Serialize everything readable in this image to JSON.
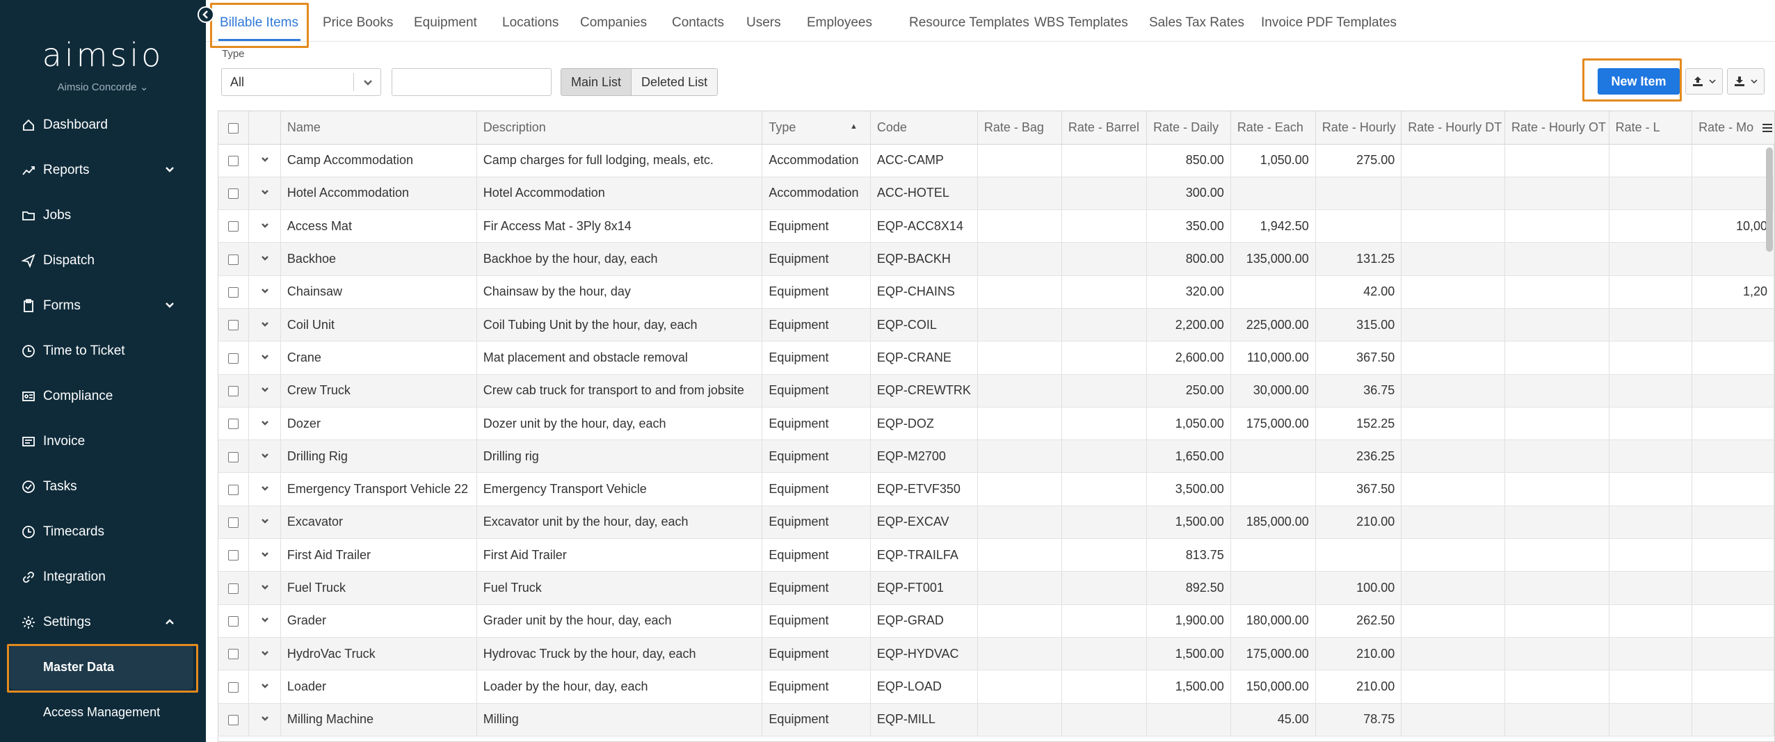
{
  "sidebar": {
    "logo": "aimsio",
    "company": "Aimsio Concorde ⌄",
    "items": [
      {
        "label": "Dashboard",
        "icon": "home-icon"
      },
      {
        "label": "Reports",
        "icon": "chart-icon",
        "expandable": true
      },
      {
        "label": "Jobs",
        "icon": "folder-icon"
      },
      {
        "label": "Dispatch",
        "icon": "send-icon"
      },
      {
        "label": "Forms",
        "icon": "clipboard-icon",
        "expandable": true
      },
      {
        "label": "Time to Ticket",
        "icon": "clock-icon"
      },
      {
        "label": "Compliance",
        "icon": "id-card-icon"
      },
      {
        "label": "Invoice",
        "icon": "invoice-icon"
      },
      {
        "label": "Tasks",
        "icon": "check-circle-icon"
      },
      {
        "label": "Timecards",
        "icon": "clock-icon"
      },
      {
        "label": "Integration",
        "icon": "link-icon"
      },
      {
        "label": "Settings",
        "icon": "gear-icon",
        "expanded": true
      }
    ],
    "sub_items": [
      "Master Data",
      "Access Management"
    ]
  },
  "tabs": [
    "Billable Items",
    "Price Books",
    "Equipment",
    "Locations",
    "Companies",
    "Contacts",
    "Users",
    "Employees",
    "Resource Templates",
    "WBS Templates",
    "Sales Tax Rates",
    "Invoice PDF Templates"
  ],
  "active_tab": "Billable Items",
  "filters": {
    "type_label": "Type",
    "type_value": "All",
    "search_value": "",
    "list_toggle": [
      "Main List",
      "Deleted List"
    ],
    "active_list": "Main List"
  },
  "toolbar": {
    "new_item_label": "New Item"
  },
  "colors": {
    "accent": "#1f77e0",
    "sidebar_bg": "#0f2b3a",
    "highlight": "#e48a1e"
  },
  "table": {
    "columns": [
      "Name",
      "Description",
      "Type",
      "Code",
      "Rate - Bag",
      "Rate - Barrel",
      "Rate - Daily",
      "Rate - Each",
      "Rate - Hourly",
      "Rate - Hourly DT",
      "Rate - Hourly OT",
      "Rate - L",
      "Rate - Mo"
    ],
    "sorted_column": "Type",
    "rows": [
      [
        "Camp Accommodation",
        "Camp charges for full lodging, meals, etc.",
        "Accommodation",
        "ACC-CAMP",
        "",
        "",
        "850.00",
        "1,050.00",
        "275.00",
        "",
        "",
        "",
        ""
      ],
      [
        "Hotel Accommodation",
        "Hotel Accommodation",
        "Accommodation",
        "ACC-HOTEL",
        "",
        "",
        "300.00",
        "",
        "",
        "",
        "",
        "",
        ""
      ],
      [
        "Access Mat",
        "Fir Access Mat - 3Ply 8x14",
        "Equipment",
        "EQP-ACC8X14",
        "",
        "",
        "350.00",
        "1,942.50",
        "",
        "",
        "",
        "",
        "10,00"
      ],
      [
        "Backhoe",
        "Backhoe by the hour, day, each",
        "Equipment",
        "EQP-BACKH",
        "",
        "",
        "800.00",
        "135,000.00",
        "131.25",
        "",
        "",
        "",
        ""
      ],
      [
        "Chainsaw",
        "Chainsaw by the hour, day",
        "Equipment",
        "EQP-CHAINS",
        "",
        "",
        "320.00",
        "",
        "42.00",
        "",
        "",
        "",
        "1,20"
      ],
      [
        "Coil Unit",
        "Coil Tubing Unit by the hour, day, each",
        "Equipment",
        "EQP-COIL",
        "",
        "",
        "2,200.00",
        "225,000.00",
        "315.00",
        "",
        "",
        "",
        ""
      ],
      [
        "Crane",
        "Mat placement and obstacle removal",
        "Equipment",
        "EQP-CRANE",
        "",
        "",
        "2,600.00",
        "110,000.00",
        "367.50",
        "",
        "",
        "",
        ""
      ],
      [
        "Crew Truck",
        "Crew cab truck for transport to and from jobsite",
        "Equipment",
        "EQP-CREWTRK",
        "",
        "",
        "250.00",
        "30,000.00",
        "36.75",
        "",
        "",
        "",
        ""
      ],
      [
        "Dozer",
        "Dozer unit by the hour, day, each",
        "Equipment",
        "EQP-DOZ",
        "",
        "",
        "1,050.00",
        "175,000.00",
        "152.25",
        "",
        "",
        "",
        ""
      ],
      [
        "Drilling Rig",
        "Drilling rig",
        "Equipment",
        "EQP-M2700",
        "",
        "",
        "1,650.00",
        "",
        "236.25",
        "",
        "",
        "",
        ""
      ],
      [
        "Emergency Transport Vehicle 22",
        "Emergency Transport Vehicle",
        "Equipment",
        "EQP-ETVF350",
        "",
        "",
        "3,500.00",
        "",
        "367.50",
        "",
        "",
        "",
        ""
      ],
      [
        "Excavator",
        "Excavator unit by the hour, day, each",
        "Equipment",
        "EQP-EXCAV",
        "",
        "",
        "1,500.00",
        "185,000.00",
        "210.00",
        "",
        "",
        "",
        ""
      ],
      [
        "First Aid Trailer",
        "First Aid Trailer",
        "Equipment",
        "EQP-TRAILFA",
        "",
        "",
        "813.75",
        "",
        "",
        "",
        "",
        "",
        ""
      ],
      [
        "Fuel Truck",
        "Fuel Truck",
        "Equipment",
        "EQP-FT001",
        "",
        "",
        "892.50",
        "",
        "100.00",
        "",
        "",
        "",
        ""
      ],
      [
        "Grader",
        "Grader unit by the hour, day, each",
        "Equipment",
        "EQP-GRAD",
        "",
        "",
        "1,900.00",
        "180,000.00",
        "262.50",
        "",
        "",
        "",
        ""
      ],
      [
        "HydroVac Truck",
        "Hydrovac Truck by the hour, day, each",
        "Equipment",
        "EQP-HYDVAC",
        "",
        "",
        "1,500.00",
        "175,000.00",
        "210.00",
        "",
        "",
        "",
        ""
      ],
      [
        "Loader",
        "Loader by the hour, day, each",
        "Equipment",
        "EQP-LOAD",
        "",
        "",
        "1,500.00",
        "150,000.00",
        "210.00",
        "",
        "",
        "",
        ""
      ],
      [
        "Milling Machine",
        "Milling",
        "Equipment",
        "EQP-MILL",
        "",
        "",
        "",
        "45.00",
        "78.75",
        "",
        "",
        "",
        ""
      ]
    ]
  }
}
